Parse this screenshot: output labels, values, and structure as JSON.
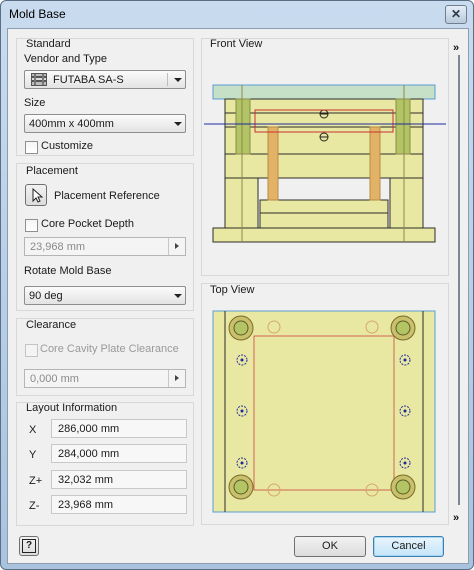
{
  "window": {
    "title": "Mold Base",
    "close_glyph": "✕"
  },
  "standard": {
    "group_label": "Standard",
    "vendor_label": "Vendor and Type",
    "vendor_value": "FUTABA SA-S",
    "size_label": "Size",
    "size_value": "400mm x 400mm",
    "customize_label": "Customize",
    "customize_checked": false
  },
  "placement": {
    "group_label": "Placement",
    "reference_label": "Placement Reference",
    "core_pocket_label": "Core Pocket Depth",
    "core_pocket_checked": false,
    "core_pocket_value": "23,968 mm",
    "rotate_label": "Rotate Mold Base",
    "rotate_value": "90 deg"
  },
  "clearance": {
    "group_label": "Clearance",
    "core_cavity_label": "Core Cavity Plate Clearance",
    "core_cavity_checked": false,
    "clearance_value": "0,000 mm"
  },
  "layout_info": {
    "group_label": "Layout Information",
    "rows": [
      {
        "key": "X",
        "value": "286,000 mm"
      },
      {
        "key": "Y",
        "value": "284,000 mm"
      },
      {
        "key": "Z+",
        "value": "32,032 mm"
      },
      {
        "key": "Z-",
        "value": "23,968 mm"
      }
    ]
  },
  "views": {
    "front_label": "Front View",
    "top_label": "Top View"
  },
  "buttons": {
    "ok_label": "OK",
    "cancel_label": "Cancel",
    "help_glyph": "?"
  },
  "scroll": {
    "chevron_glyph": "»"
  },
  "colors": {
    "plate_fill": "#e9e8a3",
    "plate_stroke": "#2b2b2b",
    "top_plate_fill": "#c6e0c8",
    "pillar_fill": "#b3c465",
    "pin_fill": "#e2b266",
    "axis_line": "#1e2a9c",
    "cut_line": "#c83030",
    "view_border": "#5b9bd5"
  }
}
